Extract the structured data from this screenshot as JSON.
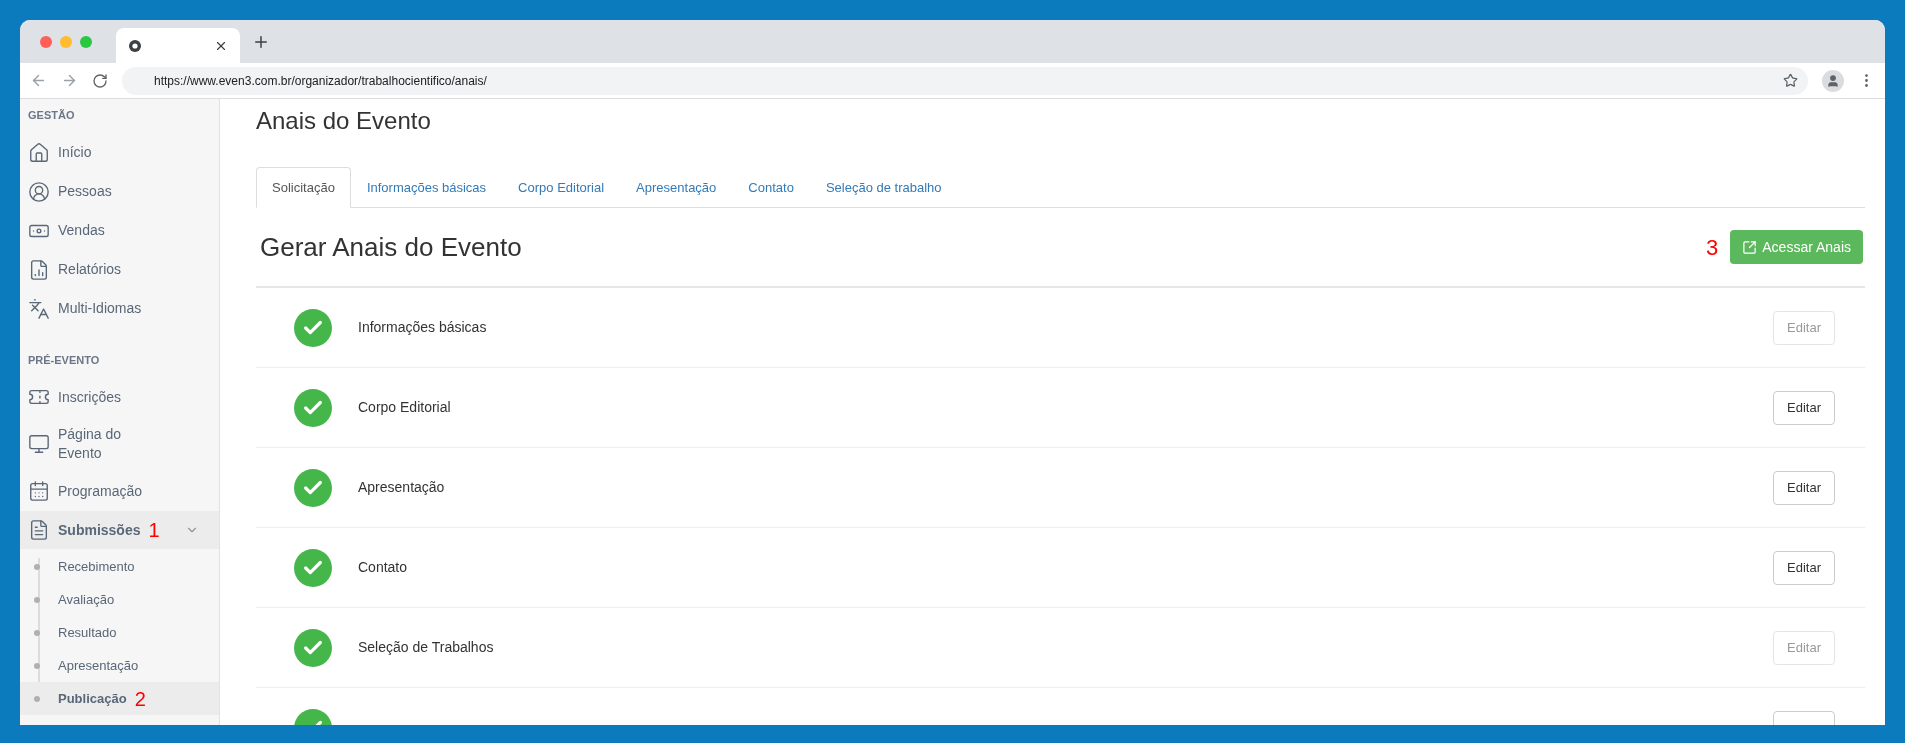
{
  "browser": {
    "url": "https://www.even3.com.br/organizador/trabalhocientifico/anais/"
  },
  "sidebar": {
    "sections": [
      {
        "heading": "GESTÃO",
        "items": [
          {
            "kind": "home",
            "label": "Início"
          },
          {
            "kind": "person",
            "label": "Pessoas"
          },
          {
            "kind": "money",
            "label": "Vendas"
          },
          {
            "kind": "report",
            "label": "Relatórios"
          },
          {
            "kind": "language",
            "label": "Multi-Idiomas"
          }
        ]
      },
      {
        "heading": "PRÉ-EVENTO",
        "items": [
          {
            "kind": "ticket",
            "label": "Inscrições"
          },
          {
            "kind": "monitor",
            "label": "Página do Evento"
          },
          {
            "kind": "calendar",
            "label": "Programação"
          },
          {
            "kind": "document",
            "label": "Submissões",
            "marker": "1",
            "expanded": true,
            "children": [
              {
                "label": "Recebimento",
                "selected": false
              },
              {
                "label": "Avaliação",
                "selected": false
              },
              {
                "label": "Resultado",
                "selected": false
              },
              {
                "label": "Apresentação",
                "selected": false
              },
              {
                "label": "Publicação",
                "selected": true,
                "marker": "2"
              }
            ]
          }
        ]
      }
    ]
  },
  "page_title": "Anais do Evento",
  "tabs": [
    {
      "label": "Solicitação",
      "selected": true
    },
    {
      "label": "Informações básicas",
      "selected": false
    },
    {
      "label": "Corpo Editorial",
      "selected": false
    },
    {
      "label": "Apresentação",
      "selected": false
    },
    {
      "label": "Contato",
      "selected": false
    },
    {
      "label": "Seleção de trabalho",
      "selected": false
    }
  ],
  "section_title": "Gerar Anais do Evento",
  "access_button": {
    "label": "Acessar Anais",
    "marker": "3"
  },
  "steps": [
    {
      "label": "Informações básicas",
      "done": true,
      "button": "Editar",
      "disabled": true
    },
    {
      "label": "Corpo Editorial",
      "done": true,
      "button": "Editar",
      "disabled": false
    },
    {
      "label": "Apresentação",
      "done": true,
      "button": "Editar",
      "disabled": false
    },
    {
      "label": "Contato",
      "done": true,
      "button": "Editar",
      "disabled": false
    },
    {
      "label": "Seleção de Trabalhos",
      "done": true,
      "button": "Editar",
      "disabled": true
    },
    {
      "done": true,
      "disabled": false
    }
  ]
}
